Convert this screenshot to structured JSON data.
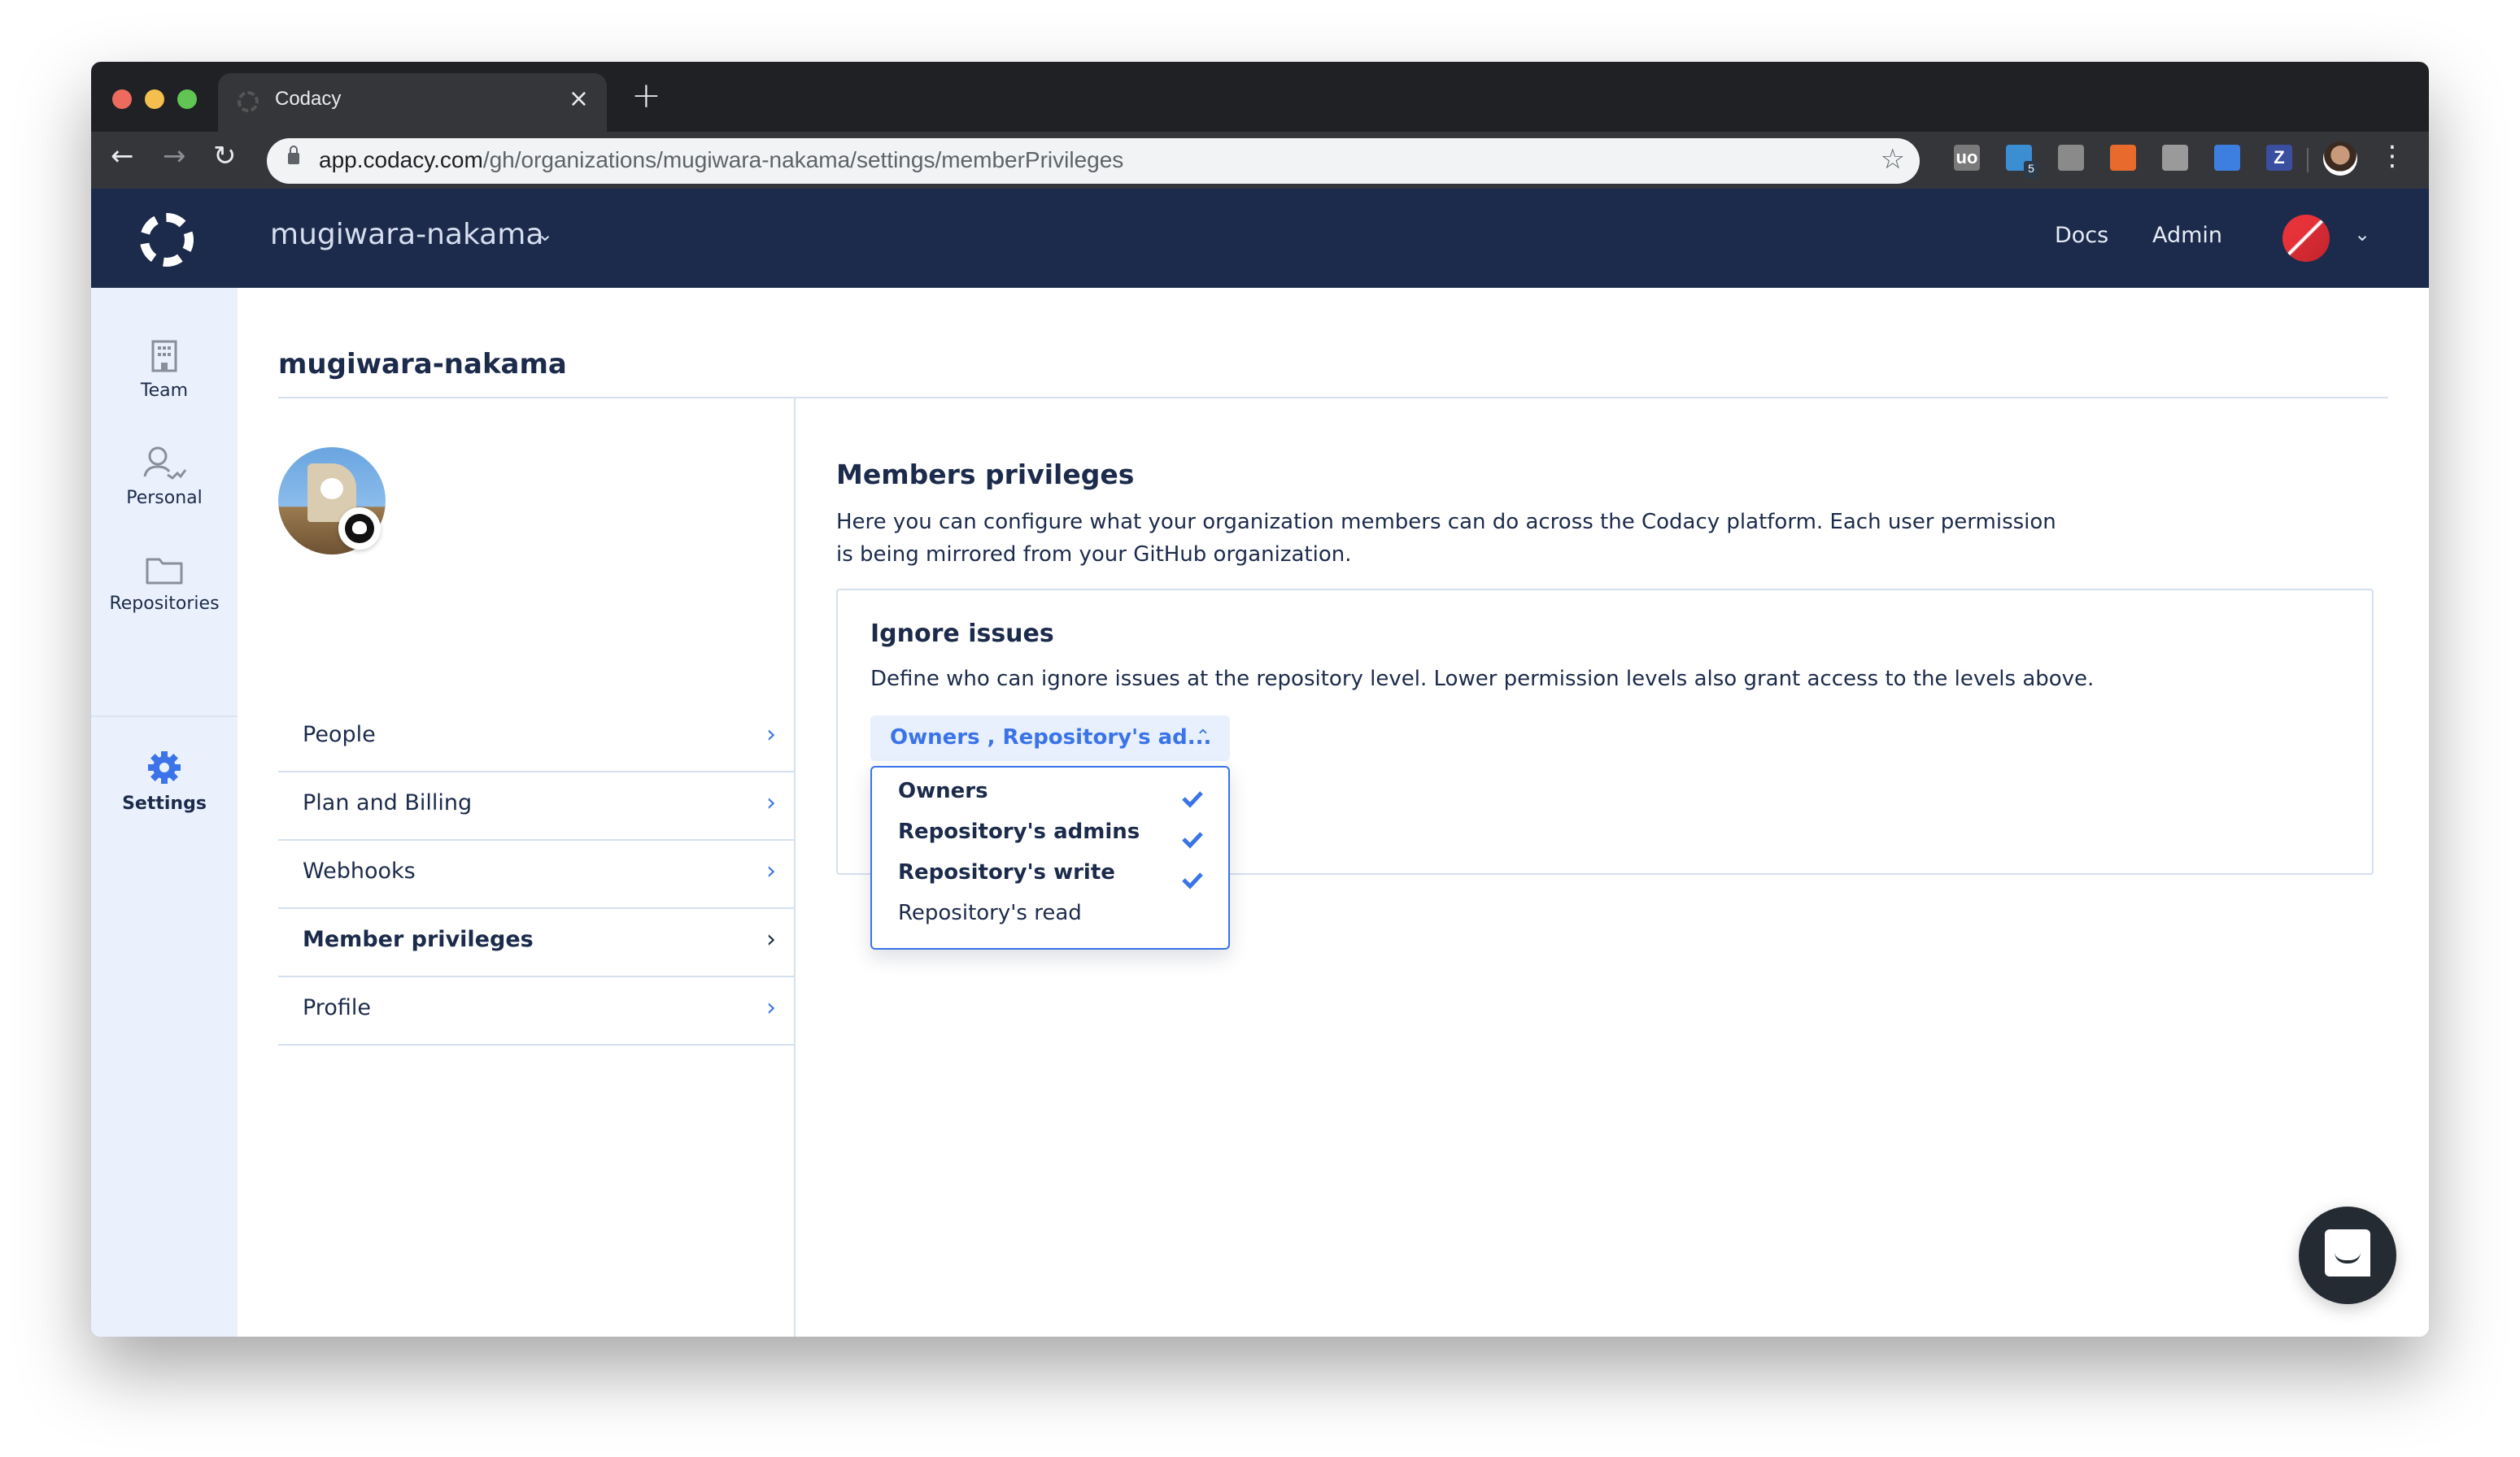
{
  "browser": {
    "tab_title": "Codacy",
    "url_host": "app.codacy.com",
    "url_path": "/gh/organizations/mugiwara-nakama/settings/memberPrivileges",
    "extensions": [
      {
        "name": "ublock-origin",
        "label": "uo",
        "color": "#7a7a7a"
      },
      {
        "name": "bitwarden",
        "label": "",
        "color": "#3b8ed2",
        "badge": "5"
      },
      {
        "name": "screenshot",
        "label": "",
        "color": "#8a8a8a"
      },
      {
        "name": "analytics",
        "label": "",
        "color": "#e86a2c"
      },
      {
        "name": "tag-manager",
        "label": "",
        "color": "#9a9a9a"
      },
      {
        "name": "tag-assistant",
        "label": "",
        "color": "#3d7fe0"
      },
      {
        "name": "zotero",
        "label": "Z",
        "color": "#3a4fa0"
      }
    ]
  },
  "header": {
    "org_name": "mugiwara-nakama",
    "links": [
      "Docs",
      "Admin"
    ]
  },
  "rail": {
    "items": [
      {
        "label": "Team",
        "icon": "building-icon",
        "active": false
      },
      {
        "label": "Personal",
        "icon": "user-check-icon",
        "active": false
      },
      {
        "label": "Repositories",
        "icon": "folder-icon",
        "active": false
      },
      {
        "label": "Settings",
        "icon": "gear-icon",
        "active": true
      }
    ]
  },
  "page": {
    "title": "mugiwara-nakama",
    "settings_nav": [
      {
        "label": "People",
        "active": false
      },
      {
        "label": "Plan and Billing",
        "active": false
      },
      {
        "label": "Webhooks",
        "active": false
      },
      {
        "label": "Member privileges",
        "active": true
      },
      {
        "label": "Profile",
        "active": false
      }
    ]
  },
  "privileges": {
    "title": "Members privileges",
    "description": "Here you can configure what your organization members can do across the Codacy platform. Each user permission is being mirrored from your GitHub organization.",
    "ignore_issues": {
      "title": "Ignore issues",
      "description": "Define who can ignore issues at the repository level. Lower permission levels also grant access to the levels above.",
      "selected_display": "Owners , Repository's ad...",
      "options": [
        {
          "label": "Owners",
          "checked": true
        },
        {
          "label": "Repository's admins",
          "checked": true
        },
        {
          "label": "Repository's write",
          "checked": true
        },
        {
          "label": "Repository's read",
          "checked": false
        }
      ]
    }
  },
  "colors": {
    "header_bg": "#1c2b4b",
    "accent": "#3a74e8",
    "rail_bg": "#eaf1fd"
  }
}
